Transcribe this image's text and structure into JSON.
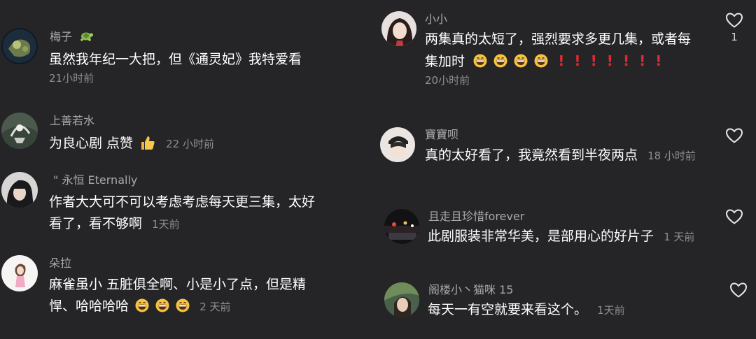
{
  "comments_left": [
    {
      "user": "梅子",
      "user_badge": "turtle-emoji",
      "text": "虽然我年纪一大把，但《通灵妃》我特爱看",
      "time": "21小时前"
    },
    {
      "user": "上善若水",
      "text": "为良心剧 点赞",
      "text_emoji": "thumbs-up-emoji",
      "time": "22 小时前"
    },
    {
      "user": "\"  永恒 Eternally",
      "text_line1": "作者大大可不可以考虑考虑每天更三集，太好",
      "text_line2": "看了，看不够啊",
      "time": "1天前"
    },
    {
      "user": "朵拉",
      "text_line1": "麻雀虽小 五脏俱全啊、小是小了点，但是精",
      "text_line2": "悍、哈哈哈哈",
      "text_emoji": "grinning-emoji",
      "time": "2 天前"
    }
  ],
  "comments_right": [
    {
      "user": "小小",
      "text_line1": "两集真的太短了，强烈要求多更几集，或者每",
      "text_line2": "集加时",
      "text_emoji": "grinning-emoji",
      "text_mark": "!",
      "time": "20小时前",
      "likes": "1"
    },
    {
      "user": "寶寶呗",
      "text": "真的太好看了，我竟然看到半夜两点",
      "time": "18 小时前"
    },
    {
      "user": "且走且珍惜forever",
      "text": "此剧服装非常华美，是部用心的好片子",
      "time": "1 天前"
    },
    {
      "user": "阁楼小丶猫咪 15",
      "text": "每天一有空就要来看这个。",
      "time": "1天前"
    }
  ],
  "colors": {
    "background": "#252528",
    "text": "#ffffff",
    "secondary": "#a9a9ad",
    "time": "#8e8e93",
    "accent_red": "#e8242c"
  }
}
